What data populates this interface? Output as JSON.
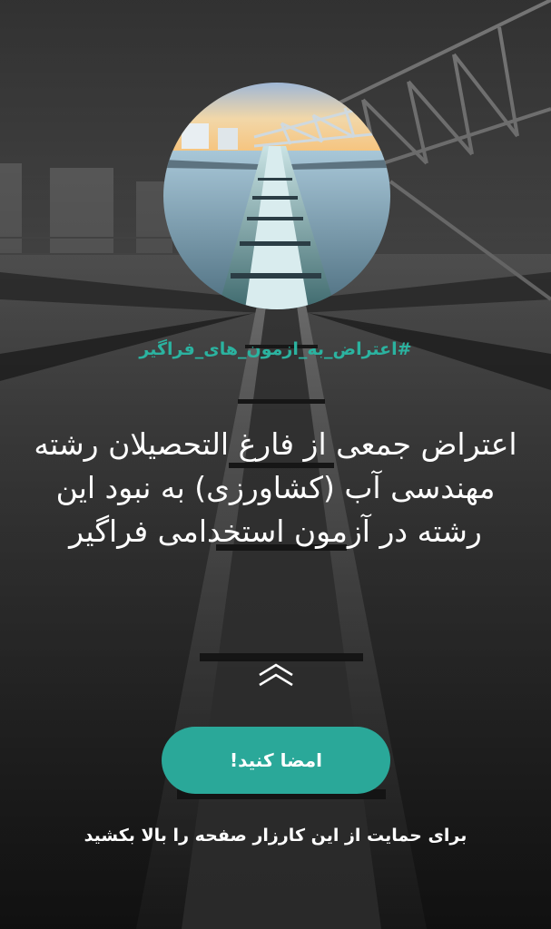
{
  "campaign": {
    "hashtag": "#اعتراض_به_ازمون_های_فراگیر",
    "headline": "اعتراض جمعی از فارغ التحصیلان رشته مهندسی آب (کشاورزی) به نبود این رشته در آزمون استخدامی فراگیر",
    "swipe_icon": "double-chevron-up-icon",
    "sign_button_label": "امضا کنید!",
    "swipe_hint": "برای حمایت از این کارزار صفحه را بالا بکشید"
  },
  "colors": {
    "accent": "#2aa899",
    "hashtag": "#2bb3a0",
    "text": "#ffffff"
  }
}
